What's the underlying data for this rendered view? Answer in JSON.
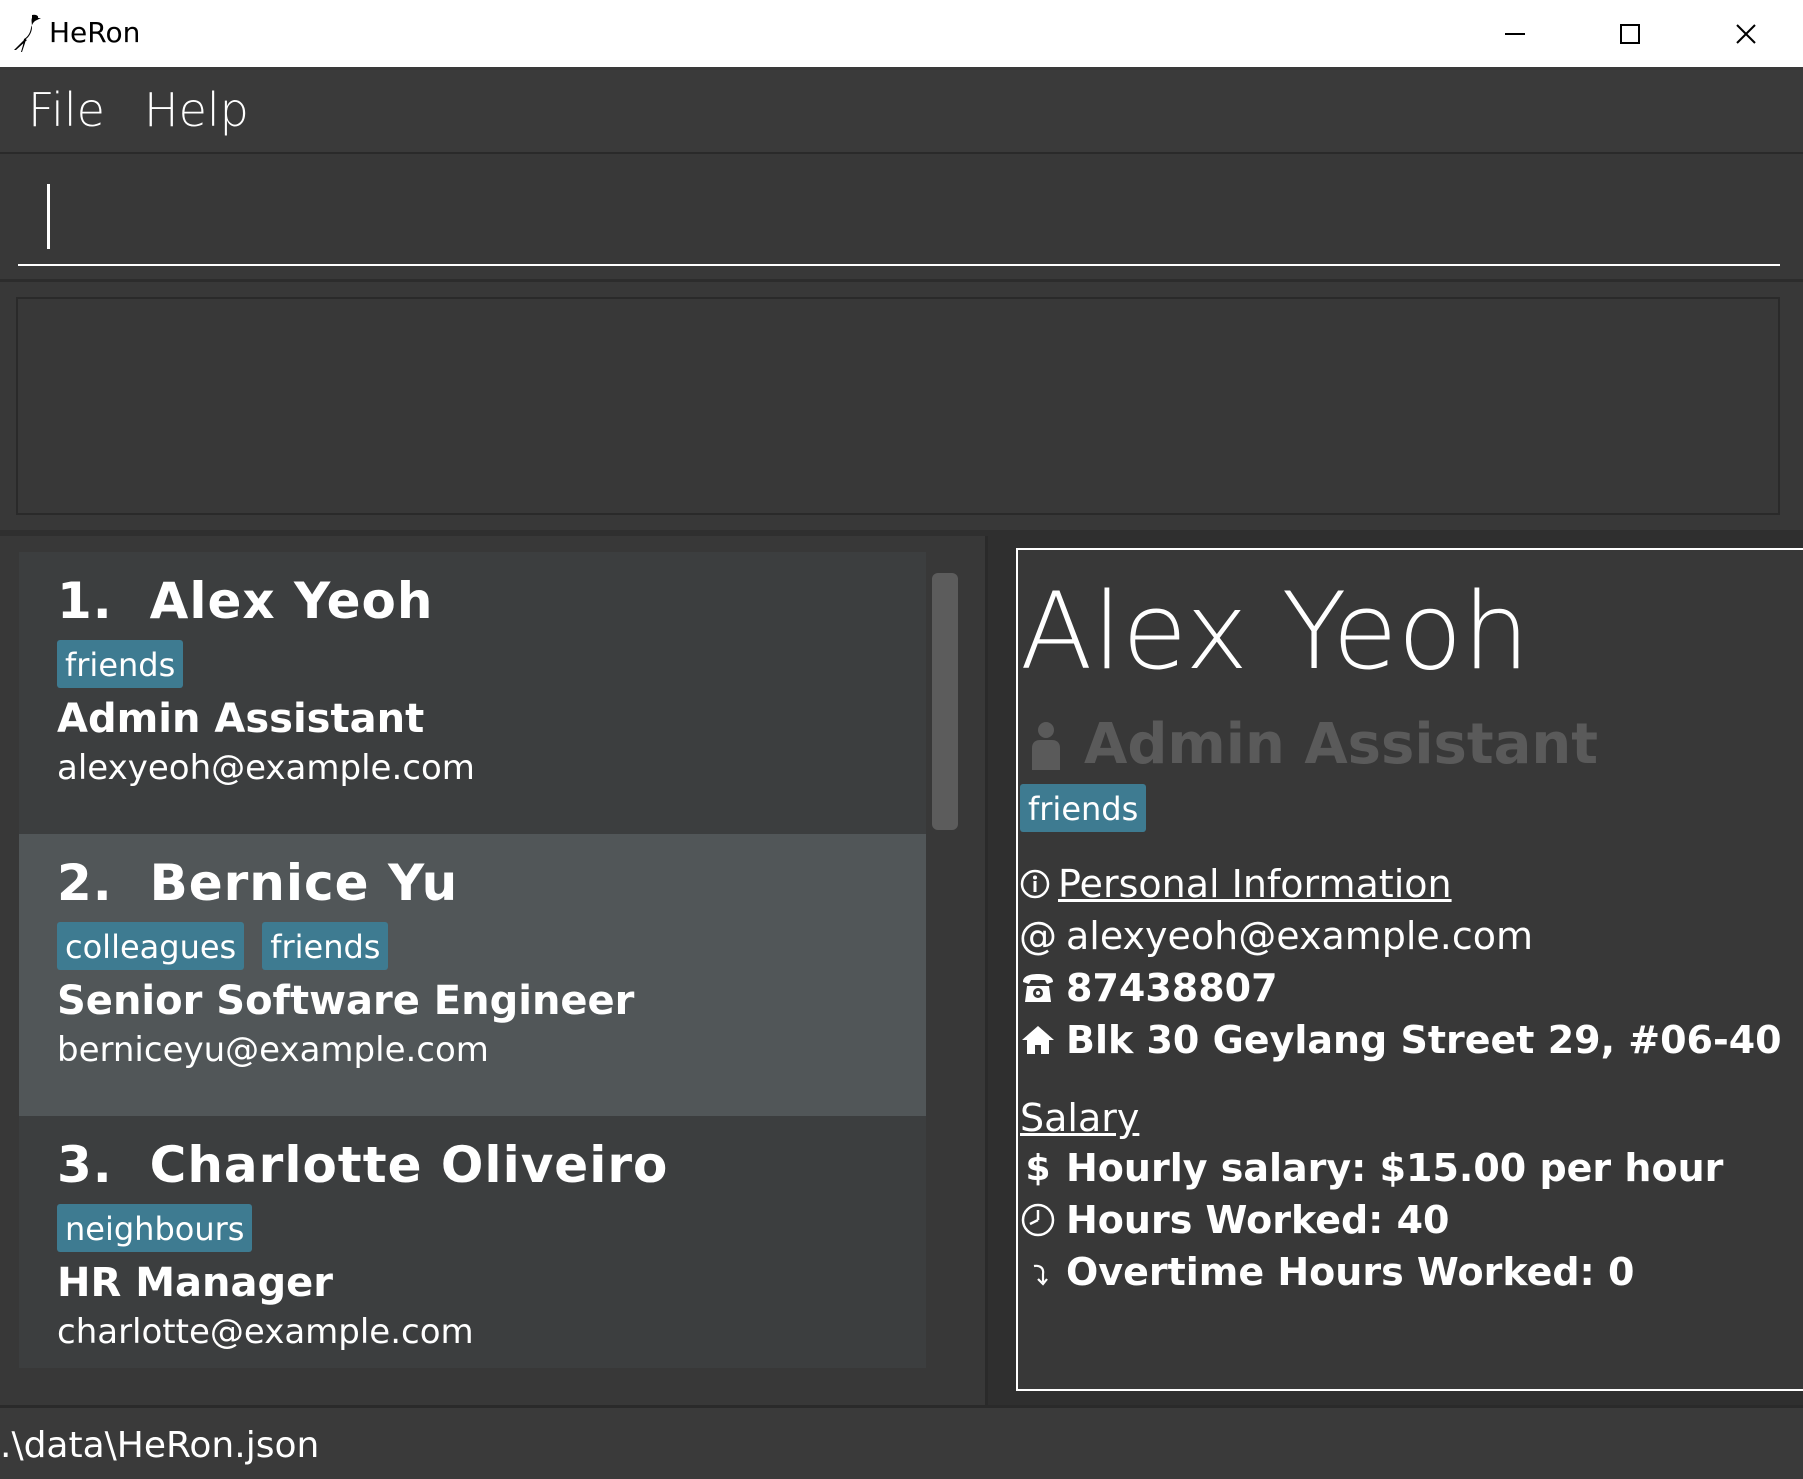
{
  "window": {
    "title": "HeRon",
    "icon": "heron-bird-icon"
  },
  "menu": {
    "file_label": "File",
    "help_label": "Help"
  },
  "command": {
    "value": "",
    "placeholder": ""
  },
  "result": {
    "text": ""
  },
  "persons": [
    {
      "index": "1.",
      "name": "Alex Yeoh",
      "tags": [
        "friends"
      ],
      "role": "Admin Assistant",
      "email": "alexyeoh@example.com"
    },
    {
      "index": "2.",
      "name": "Bernice Yu",
      "tags": [
        "colleagues",
        "friends"
      ],
      "role": "Senior Software Engineer",
      "email": "berniceyu@example.com",
      "selected": true
    },
    {
      "index": "3.",
      "name": "Charlotte Oliveiro",
      "tags": [
        "neighbours"
      ],
      "role": "HR Manager",
      "email": "charlotte@example.com"
    }
  ],
  "detail": {
    "name": "Alex Yeoh",
    "role": "Admin Assistant",
    "tags": [
      "friends"
    ],
    "personal_heading": "Personal Information",
    "email": "alexyeoh@example.com",
    "phone": "87438807",
    "address": "Blk 30 Geylang Street 29, #06-40",
    "salary_heading": "Salary",
    "hourly_salary": "Hourly salary: $15.00 per hour",
    "hours_worked": "Hours Worked: 40",
    "overtime": "Overtime Hours Worked: 0"
  },
  "status": {
    "path": ".\\data\\HeRon.json"
  },
  "colors": {
    "background": "#383838",
    "tag": "#3e7b91",
    "card": "#3c3e3f",
    "card_selected": "#515658",
    "role_muted": "#5a5a5a"
  }
}
